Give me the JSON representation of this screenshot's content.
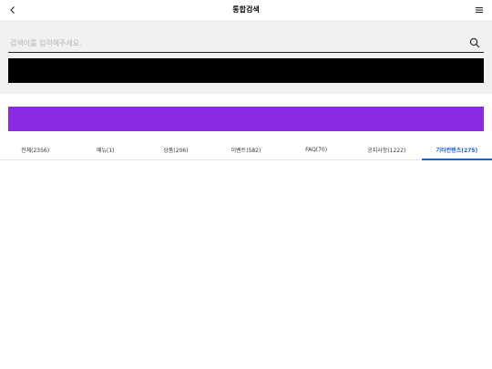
{
  "header": {
    "title": "통합검색",
    "back_icon": "chevron-left-icon",
    "menu_icon": "hamburger-menu-icon"
  },
  "search": {
    "placeholder": "검색어를 입력해주세요.",
    "value": "",
    "icon": "search-icon"
  },
  "banners": {
    "top_color": "#000000",
    "bottom_color": "#8a2be2"
  },
  "tabs": [
    {
      "label": "전체(2356)",
      "active": false
    },
    {
      "label": "메뉴(1)",
      "active": false
    },
    {
      "label": "상품(206)",
      "active": false
    },
    {
      "label": "이벤트(582)",
      "active": false
    },
    {
      "label": "FAQ(70)",
      "active": false
    },
    {
      "label": "공지사항(1222)",
      "active": false
    },
    {
      "label": "기타컨텐츠(275)",
      "active": true
    }
  ],
  "accent_color": "#1b5fcf"
}
